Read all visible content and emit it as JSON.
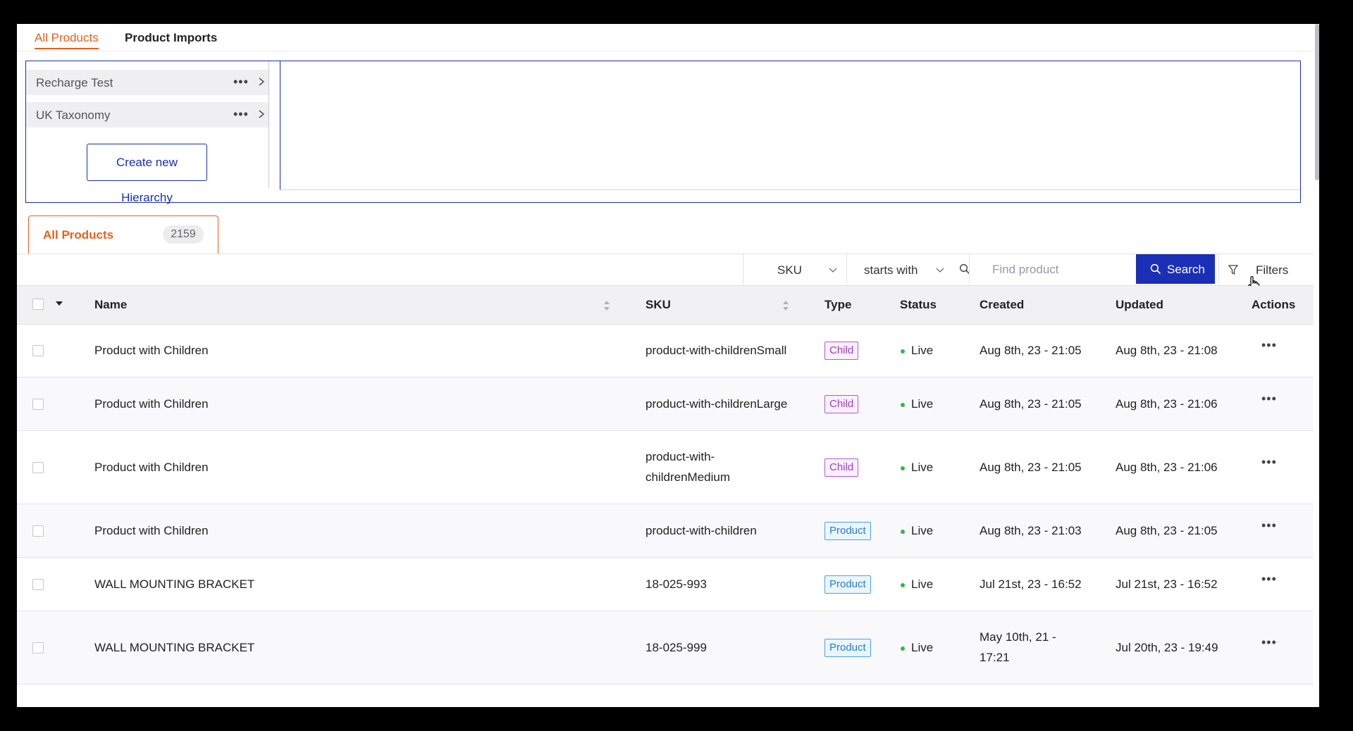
{
  "top_tabs": [
    {
      "label": "All Products",
      "active": true
    },
    {
      "label": "Product Imports",
      "active": false
    }
  ],
  "hierarchies": {
    "items": [
      {
        "name": "Recharge Test",
        "menu_icon": "more-dots-icon",
        "expand_icon": "chevron-right-icon"
      },
      {
        "name": "UK Taxonomy",
        "menu_icon": "more-dots-icon",
        "expand_icon": "chevron-right-icon"
      }
    ],
    "create_button": "Create new Hierarchy"
  },
  "product_tab": {
    "label": "All Products",
    "count": "2159"
  },
  "search": {
    "field_select": "SKU",
    "operator_select": "starts with",
    "placeholder": "Find product",
    "search_button": "Search",
    "filters_button": "Filters"
  },
  "table": {
    "columns": [
      "Name",
      "SKU",
      "Type",
      "Status",
      "Created",
      "Updated",
      "Actions"
    ],
    "rows": [
      {
        "name": "Product with Children",
        "sku": "product-with-childrenSmall",
        "sku_lines": [
          "product-with-childrenSmall"
        ],
        "type": "Child",
        "status": "Live",
        "created": "Aug 8th, 23 - 21:05",
        "created_lines": [
          "Aug 8th, 23 - 21:05"
        ],
        "updated": "Aug 8th, 23 - 21:08"
      },
      {
        "name": "Product with Children",
        "sku": "product-with-childrenLarge",
        "sku_lines": [
          "product-with-childrenLarge"
        ],
        "type": "Child",
        "status": "Live",
        "created": "Aug 8th, 23 - 21:05",
        "created_lines": [
          "Aug 8th, 23 - 21:05"
        ],
        "updated": "Aug 8th, 23 - 21:06"
      },
      {
        "name": "Product with Children",
        "sku": "product-with-childrenMedium",
        "sku_lines": [
          "product-with-",
          "childrenMedium"
        ],
        "type": "Child",
        "status": "Live",
        "created": "Aug 8th, 23 - 21:05",
        "created_lines": [
          "Aug 8th, 23 - 21:05"
        ],
        "updated": "Aug 8th, 23 - 21:06"
      },
      {
        "name": "Product with Children",
        "sku": "product-with-children",
        "sku_lines": [
          "product-with-children"
        ],
        "type": "Product",
        "status": "Live",
        "created": "Aug 8th, 23 - 21:03",
        "created_lines": [
          "Aug 8th, 23 - 21:03"
        ],
        "updated": "Aug 8th, 23 - 21:05"
      },
      {
        "name": "WALL MOUNTING BRACKET",
        "sku": "18-025-993",
        "sku_lines": [
          "18-025-993"
        ],
        "type": "Product",
        "status": "Live",
        "created": "Jul 21st, 23 - 16:52",
        "created_lines": [
          "Jul 21st, 23 - 16:52"
        ],
        "updated": "Jul 21st, 23 - 16:52"
      },
      {
        "name": "WALL MOUNTING BRACKET",
        "sku": "18-025-999",
        "sku_lines": [
          "18-025-999"
        ],
        "type": "Product",
        "status": "Live",
        "created": "May 10th, 21 - 17:21",
        "created_lines": [
          "May 10th, 21 -",
          "17:21"
        ],
        "updated": "Jul 20th, 23 - 19:49"
      }
    ]
  },
  "colors": {
    "accent_orange": "#e8611a",
    "primary_blue": "#1a2fb5",
    "status_live": "#37b24d",
    "badge_child": "#9b3fbf",
    "badge_product": "#2a7fc4"
  },
  "icons": {
    "search_input": "search-icon",
    "search_button": "search-icon",
    "filters": "filter-funnel-icon",
    "cursor": "hand-pointer-icon",
    "row_actions": "more-dots-icon"
  }
}
